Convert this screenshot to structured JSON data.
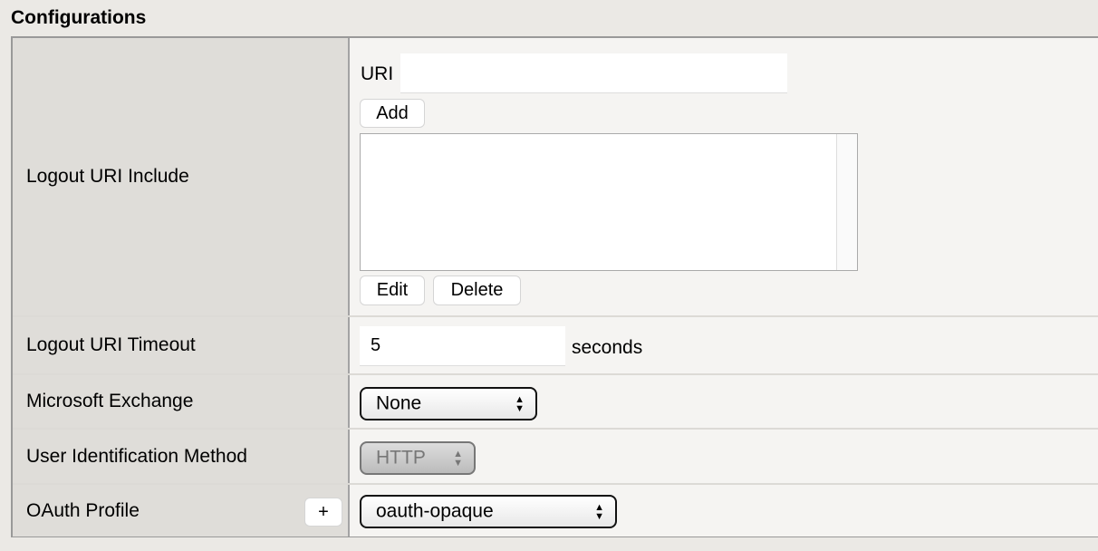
{
  "section_title": "Configurations",
  "rows": {
    "logout_uri_include": {
      "label": "Logout URI Include",
      "uri_label": "URI",
      "uri_value": "",
      "add_label": "Add",
      "list_items": [],
      "edit_label": "Edit",
      "delete_label": "Delete"
    },
    "logout_uri_timeout": {
      "label": "Logout URI Timeout",
      "value": "5",
      "unit": "seconds"
    },
    "microsoft_exchange": {
      "label": "Microsoft Exchange",
      "selected": "None"
    },
    "user_identification_method": {
      "label": "User Identification Method",
      "selected": "HTTP",
      "disabled": true
    },
    "oauth_profile": {
      "label": "OAuth Profile",
      "add_label": "+",
      "selected": "oauth-opaque"
    }
  },
  "icons": {
    "select_arrows": "up-down-arrows-icon"
  }
}
